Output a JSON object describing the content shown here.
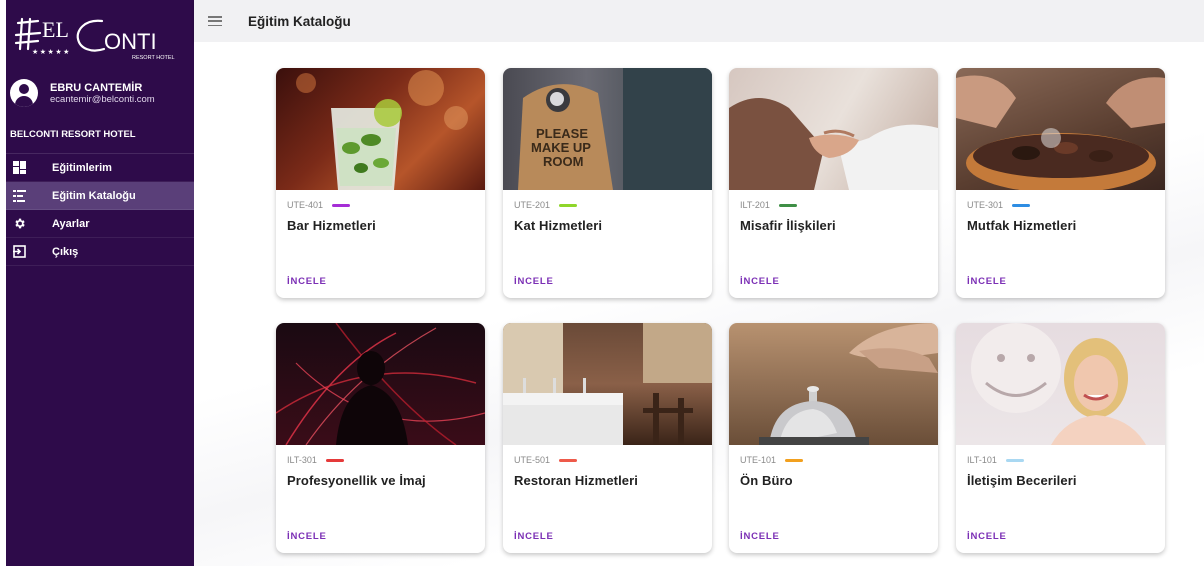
{
  "brand": {
    "logo_text": "B",
    "logo_text2": "EL",
    "logo_text3": "ONTI",
    "logo_stars": "★★★★★",
    "logo_sub": "RESORT HOTEL"
  },
  "user": {
    "name": "EBRU CANTEMİR",
    "email": "ecantemir@belconti.com"
  },
  "hotel_name": "BELCONTI RESORT HOTEL",
  "sidebar": {
    "items": [
      {
        "label": "Eğitimlerim",
        "icon": "dashboard-icon",
        "active": false
      },
      {
        "label": "Eğitim Kataloğu",
        "icon": "list-icon",
        "active": true
      },
      {
        "label": "Ayarlar",
        "icon": "gear-icon",
        "active": false
      },
      {
        "label": "Çıkış",
        "icon": "logout-icon",
        "active": false
      }
    ]
  },
  "header": {
    "title": "Eğitim Kataloğu"
  },
  "catalog": {
    "button_label": "İNCELE",
    "courses": [
      {
        "code": "UTE-401",
        "title": "Bar Hizmetleri",
        "color": "#a52dd6"
      },
      {
        "code": "UTE-201",
        "title": "Kat Hizmetleri",
        "color": "#8fd62a"
      },
      {
        "code": "ILT-201",
        "title": "Misafir İlişkileri",
        "color": "#3f8f46"
      },
      {
        "code": "UTE-301",
        "title": "Mutfak Hizmetleri",
        "color": "#2e8de3"
      },
      {
        "code": "ILT-301",
        "title": "Profesyonellik ve İmaj",
        "color": "#e53a3a"
      },
      {
        "code": "UTE-501",
        "title": "Restoran Hizmetleri",
        "color": "#ee5a4a"
      },
      {
        "code": "UTE-101",
        "title": "Ön Büro",
        "color": "#f2a01e"
      },
      {
        "code": "ILT-101",
        "title": "İletişim Becerileri",
        "color": "#a9d8f2"
      }
    ]
  },
  "door_sign": {
    "line1": "PLEASE",
    "line2": "MAKE UP",
    "line3": "ROOM"
  },
  "colors": {
    "sidebar": "#2e0b4a",
    "sidebar_active": "#5a3f79",
    "accent": "#7b2fb5"
  }
}
